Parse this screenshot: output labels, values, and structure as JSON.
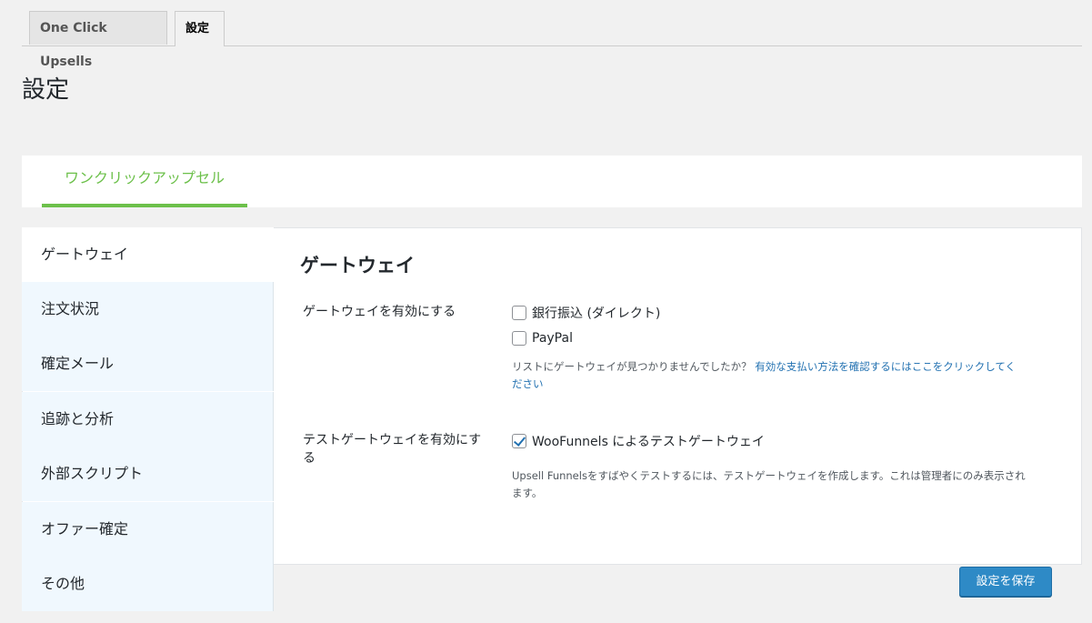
{
  "tabs": [
    {
      "label": "One Click Upsells"
    },
    {
      "label": "設定"
    }
  ],
  "page_title": "設定",
  "sub_tab": "ワンクリックアップセル",
  "side_menu": [
    {
      "label": "ゲートウェイ"
    },
    {
      "label": "注文状況"
    },
    {
      "label": "確定メール"
    },
    {
      "label": "追跡と分析"
    },
    {
      "label": "外部スクリプト"
    },
    {
      "label": "オファー確定"
    },
    {
      "label": "その他"
    }
  ],
  "content": {
    "title": "ゲートウェイ",
    "gateway_label": "ゲートウェイを有効にする",
    "gateways": [
      {
        "label": "銀行振込 (ダイレクト)",
        "checked": false
      },
      {
        "label": "PayPal",
        "checked": false
      }
    ],
    "gateway_note": "リストにゲートウェイが見つかりませんでしたか？",
    "gateway_note_link_1": "有効な支払い方法を確認するにはここをクリックしてく",
    "gateway_note_link_2": "ださい",
    "test_label": "テストゲートウェイを有効にする",
    "test_gateway": {
      "label": "WooFunnels によるテストゲートウェイ",
      "checked": true
    },
    "test_note_1": "Upsell Funnelsをすばやくテストするには、テストゲートウェイを作成します。これは管理者にのみ表示され",
    "test_note_2": "ます。"
  },
  "save_button": "設定を保存",
  "colors": {
    "accent_green": "#6cc04a",
    "button_blue": "#2e8ac6",
    "link_blue": "#2271b1",
    "menu_bg": "#f0f8fe"
  }
}
